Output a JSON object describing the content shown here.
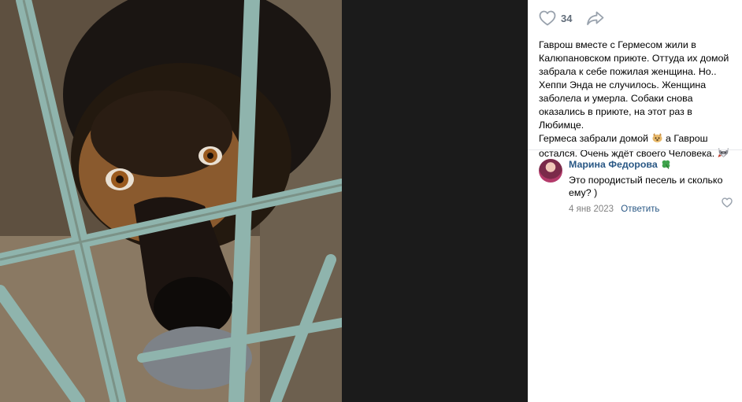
{
  "post": {
    "likes": "34",
    "text_lines": [
      "Гаврош вместе с Гермесом жили в Калюпановском приюте. Оттуда их домой забрала к себе пожилая женщина. Но.. Хеппи Энда не случилось. Женщина заболела и умерла. Собаки снова оказались в приюте, на этот раз в Любимце.",
      "Гермеса забрали домой",
      "а Гаврош остался. Очень ждёт своего Человека."
    ]
  },
  "comment": {
    "author": "Марина Федорова",
    "text": "Это породистый песель и сколько ему? )",
    "date": "4 янв 2023",
    "reply_label": "Ответить"
  },
  "icons": {
    "like": "heart-icon",
    "share": "share-arrow-icon",
    "dog_emoji": "dog-emoji-icon",
    "wolf_emoji": "wolf-emoji-icon",
    "author_badge": "clover-emoji-icon"
  },
  "colors": {
    "link": "#2a5885",
    "muted": "#828282",
    "icon": "#99a2ad",
    "background_dark": "#1b1b1b"
  }
}
